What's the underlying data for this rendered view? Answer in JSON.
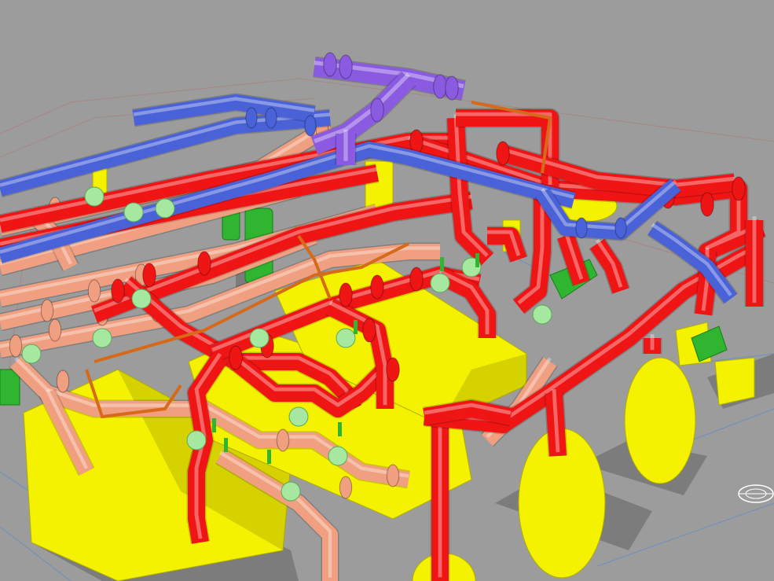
{
  "scene": {
    "view": "3d-isometric",
    "colors": {
      "background": "#9c9c9c",
      "floor_lines": "#a88585",
      "plan_lines": "#6b8fbf",
      "red_pipe": "#f01515",
      "salmon_pipe": "#f0a080",
      "blue_pipe": "#4a62d8",
      "purple_pipe": "#8a5ae0",
      "yellow_equipment": "#f4f200",
      "green_valve": "#2fb52f",
      "light_green_fitting": "#a7e8a0",
      "orange_thin_pipe": "#d76a1a",
      "equipment_shadow": "#7c7c7c"
    },
    "icons": [
      "view-cube-icon"
    ]
  }
}
